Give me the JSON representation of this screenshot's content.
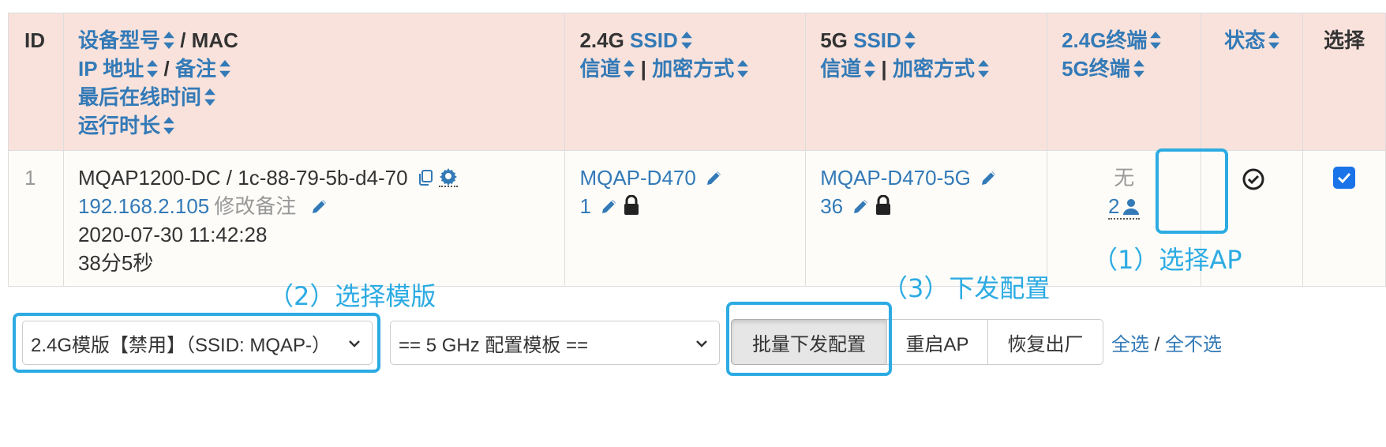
{
  "table": {
    "headers": {
      "id": "ID",
      "device": {
        "model": "设备型号",
        "sep1": " / ",
        "mac": "MAC",
        "ip": "IP 地址",
        "sep2": " / ",
        "note": "备注",
        "last_online": "最后在线时间",
        "uptime": "运行时长"
      },
      "ssid24": {
        "prefix": "2.4G ",
        "ssid": "SSID",
        "channel": "信道",
        "sep": " | ",
        "encryption": "加密方式"
      },
      "ssid5": {
        "prefix": "5G ",
        "ssid": "SSID",
        "channel": "信道",
        "sep": " | ",
        "encryption": "加密方式"
      },
      "terminals": {
        "t24": "2.4G终端",
        "t5": "5G终端"
      },
      "status": "状态",
      "select": "选择"
    },
    "rows": [
      {
        "id": "1",
        "model_mac": "MQAP1200-DC / 1c-88-79-5b-d4-70",
        "ip": "192.168.2.105",
        "note": "修改备注",
        "last_online": "2020-07-30 11:42:28",
        "uptime": "38分5秒",
        "ssid24": "MQAP-D470",
        "channel24": "1",
        "ssid5": "MQAP-D470-5G",
        "channel5": "36",
        "terminals24": "无",
        "terminals5": "2",
        "status_icon": "check-circle-icon",
        "selected": true
      }
    ]
  },
  "controls": {
    "template24_selected": "2.4G模版【禁用】（SSID: MQAP-）",
    "template5_selected": "== 5 GHz 配置模板 ==",
    "buttons": {
      "batch_push": "批量下发配置",
      "reboot": "重启AP",
      "factory_reset": "恢复出厂"
    },
    "select_all": "全选",
    "slash": " / ",
    "select_none": "全不选"
  },
  "annotations": {
    "step1": "（1）选择AP",
    "step2": "（2）选择模版",
    "step3": "（3）下发配置"
  },
  "colors": {
    "header_bg": "#f9e2db",
    "link": "#337ab7",
    "annotation": "#2cabe3",
    "checkbox": "#1a73e8"
  }
}
